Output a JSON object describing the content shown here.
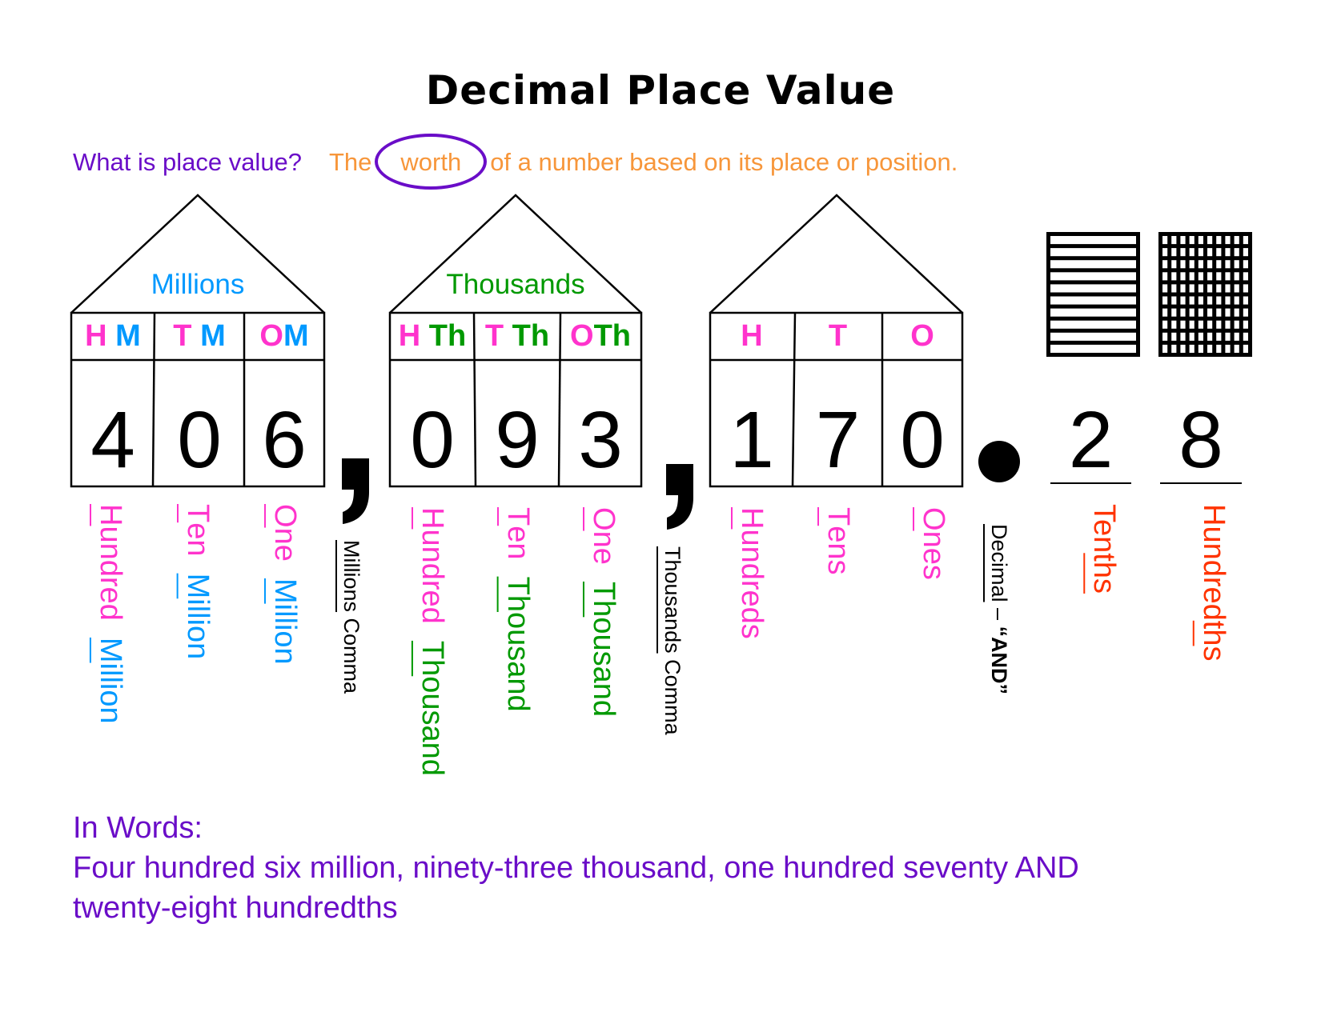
{
  "title": "Decimal Place Value",
  "question": {
    "prompt": "What is place value?",
    "answer_before": "The",
    "answer_circled": "worth",
    "answer_after": "of a number based on its place or position."
  },
  "houses": [
    {
      "name": "Millions",
      "headers": [
        {
          "a": "H",
          "b": "M"
        },
        {
          "a": "T",
          "b": "M"
        },
        {
          "a": "O",
          "b": "M"
        }
      ],
      "digits": [
        "4",
        "0",
        "6"
      ],
      "labels": [
        {
          "first_letter": "H",
          "first_rest": "undred",
          "second_letter": "M",
          "second_rest": "illion"
        },
        {
          "first_letter": "T",
          "first_rest": "en",
          "second_letter": "M",
          "second_rest": "illion"
        },
        {
          "first_letter": "O",
          "first_rest": "ne",
          "second_letter": "M",
          "second_rest": "illion"
        }
      ]
    },
    {
      "name": "Thousands",
      "headers": [
        {
          "a": "H",
          "b": "Th"
        },
        {
          "a": "T",
          "b": "Th"
        },
        {
          "a": "O",
          "b": "Th"
        }
      ],
      "digits": [
        "0",
        "9",
        "3"
      ],
      "labels": [
        {
          "first_letter": "H",
          "first_rest": "undred",
          "second_letter": "Th",
          "second_rest": "ousand"
        },
        {
          "first_letter": "T",
          "first_rest": "en",
          "second_letter": "Th",
          "second_rest": "ousand"
        },
        {
          "first_letter": "O",
          "first_rest": "ne",
          "second_letter": "Th",
          "second_rest": "ousand"
        }
      ]
    },
    {
      "name": "",
      "headers": [
        {
          "a": "H",
          "b": ""
        },
        {
          "a": "T",
          "b": ""
        },
        {
          "a": "O",
          "b": ""
        }
      ],
      "digits": [
        "1",
        "7",
        "0"
      ],
      "labels": [
        {
          "first_letter": "H",
          "first_rest": "undreds"
        },
        {
          "first_letter": "T",
          "first_rest": "ens"
        },
        {
          "first_letter": "O",
          "first_rest": "nes"
        }
      ]
    }
  ],
  "commas": [
    {
      "symbol": ",",
      "label_underlined": "Millions",
      "label_rest": " Comma"
    },
    {
      "symbol": ",",
      "label_underlined": "Thousands",
      "label_rest": " Comma"
    }
  ],
  "decimal_point": {
    "label_underlined": "Decimal",
    "label_dash": " – ",
    "label_bold": "“AND”"
  },
  "decimals": [
    {
      "digit": "2",
      "label_before": "Ten",
      "label_underlined": "ths",
      "label_after": "",
      "model": "tenths-strips",
      "model_divisions": 10
    },
    {
      "digit": "8",
      "label_before": "Hundred",
      "label_underlined": "th",
      "label_after": "s",
      "model": "hundredths-grid",
      "model_divisions": 100
    }
  ],
  "in_words": {
    "heading": "In Words:",
    "line1": "Four hundred six million, ninety-three thousand, one hundred seventy AND",
    "line2": "twenty-eight hundredths"
  },
  "colors": {
    "purple": "#6a0dc8",
    "orange": "#f7963a",
    "pink": "#ff33cc",
    "blue": "#0099ff",
    "green": "#009900",
    "red": "#ff3300"
  }
}
